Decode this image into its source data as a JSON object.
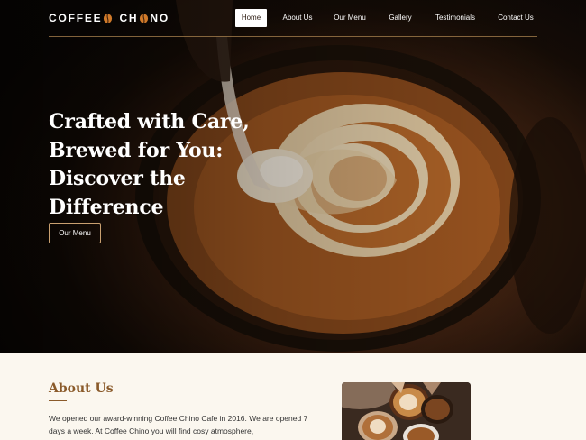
{
  "brand": {
    "logo_text_left": "COFFEE",
    "logo_text_right": "CH",
    "logo_text_end": "NO"
  },
  "nav": {
    "items": [
      {
        "label": "Home",
        "active": true
      },
      {
        "label": "About Us",
        "active": false
      },
      {
        "label": "Our Menu",
        "active": false
      },
      {
        "label": "Gallery",
        "active": false
      },
      {
        "label": "Testimonials",
        "active": false
      },
      {
        "label": "Contact Us",
        "active": false
      }
    ]
  },
  "hero": {
    "title": "Crafted with Care, Brewed for You: Discover the Difference",
    "cta_label": "Our Menu",
    "image": "latte-art-pour-image"
  },
  "about": {
    "title": "About Us",
    "text": "We opened our award-winning Coffee Chino Cafe in 2016. We are opened 7 days a week. At Coffee Chino you will find cosy atmosphere,",
    "image": "coffee-cups-cheers-image"
  },
  "colors": {
    "accent": "#8a5a2a",
    "cta_border": "#c9a070",
    "page_bg": "#fbf7ef"
  }
}
